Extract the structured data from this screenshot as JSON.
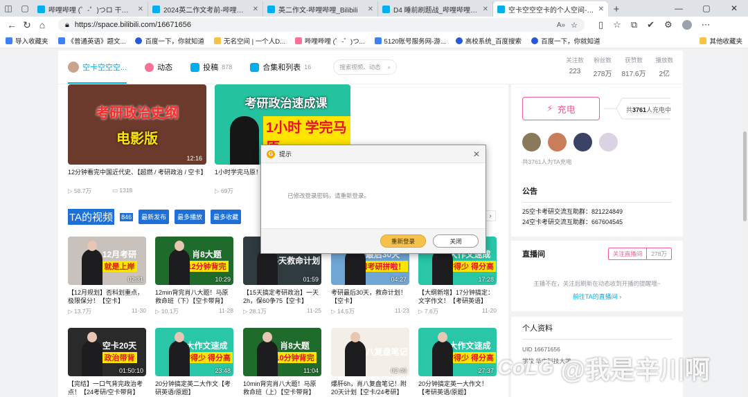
{
  "browser": {
    "tabs": [
      {
        "title": "哔哩哔哩 (゜-゜)つロ 干杯~-bilibili",
        "active": false
      },
      {
        "title": "2024英二作文考前-哔哩哔哩_Bilibili",
        "active": false
      },
      {
        "title": "英二作文-哔哩哔哩_Bilibili",
        "active": false
      },
      {
        "title": "D4 睡前刷题战_哔哩哔哩_bilibili",
        "active": false
      },
      {
        "title": "空卡空空空卡的个人空间-空卡",
        "active": true
      }
    ],
    "url": "https://space.bilibili.com/16671656",
    "reader_label": "A»",
    "bookmarks": [
      {
        "label": "导入收藏夹",
        "icon": "import-icon"
      },
      {
        "label": "《普通英语》题文...",
        "icon": "bookmark-icon"
      },
      {
        "label": "百度一下，你就知道",
        "icon": "baidu-paw-icon"
      },
      {
        "label": "无名空间 | 一个人D...",
        "icon": "bookmark-icon"
      },
      {
        "label": "哔哩哔哩 (゜-゜)つ...",
        "icon": "bilibili-icon"
      },
      {
        "label": "5120账号服务网-游...",
        "icon": "bookmark-icon"
      },
      {
        "label": "高校系统_百度搜索",
        "icon": "baidu-paw-icon"
      },
      {
        "label": "百度一下，你就知道",
        "icon": "baidu-paw-icon"
      }
    ],
    "other_bookmarks": "其他收藏夹"
  },
  "nav": {
    "username": "空卡空空空...",
    "dynamics": "动态",
    "submissions": "投稿",
    "submissions_count": "878",
    "collections": "合集和列表",
    "collections_count": "16",
    "search_placeholder": "搜索视频、动态",
    "stats": [
      {
        "label": "关注数",
        "value": "223"
      },
      {
        "label": "粉丝数",
        "value": "278万"
      },
      {
        "label": "获赞数",
        "value": "817.6万"
      },
      {
        "label": "播放数",
        "value": "2亿"
      }
    ]
  },
  "top_videos": [
    {
      "thumb_title": "考研政治史纲",
      "thumb_sub": "电影版",
      "duration": "12:16",
      "title": "12分钟看完中国近代史、【超燃 / 考研政治 / 空卡】",
      "plays": "58.7万",
      "danmaku": "1318",
      "bg": "#6b3a2c"
    },
    {
      "thumb_title": "考研政治速成课",
      "thumb_sub": "1小时 学完马原",
      "duration": "",
      "title": "1小时学完马原！",
      "plays": "69万",
      "danmaku": "",
      "bg": "#25c2a0"
    }
  ],
  "videos_section": {
    "title": "TA的视频",
    "count": "846",
    "sort_newest": "最新发布",
    "sort_most_played": "最多播放",
    "sort_most_fav": "最多收藏"
  },
  "videos": [
    {
      "thumb_title": "12月考研",
      "thumb_sub": "就是上岸",
      "duration": "02:31",
      "title": "【12月规划】否科划重点，极限保分！【空卡】",
      "plays": "13.7万",
      "date": "11-30",
      "bg": "#c9c2bc"
    },
    {
      "thumb_title": "肖8大题",
      "thumb_sub": "12分钟背完",
      "duration": "10:29",
      "title": "12min背完肖八大题！马原救命班（下）【空卡带背】",
      "plays": "10.1万",
      "date": "11-28",
      "bg": "#1f6b2c"
    },
    {
      "thumb_title": "15天救命计划",
      "thumb_sub": "",
      "duration": "01:59",
      "title": "【15天搞定考研政治】一天2h，保60争75【空卡】",
      "plays": "28.1万",
      "date": "11-25",
      "bg": "#2f3b3f"
    },
    {
      "thumb_title": "最后30天",
      "thumb_sub": "和考研拼啦！",
      "duration": "04:27",
      "title": "考研最后30天，救命计划！【空卡】",
      "plays": "14.5万",
      "date": "11-23",
      "bg": "#6fa6d6"
    },
    {
      "thumb_title": "大作文速成",
      "thumb_sub": "背得少 得分高",
      "duration": "17:28",
      "title": "【大纲新增】17分钟搞定：文字作文！【考研英语】",
      "plays": "7.6万",
      "date": "11-20",
      "bg": "#29c6a8"
    },
    {
      "thumb_title": "空卡20天",
      "thumb_sub": "政治带背",
      "duration": "01:50:10",
      "title": "【完结】一口气背完政治考点！【24考研/空卡带背】",
      "plays": "",
      "date": "",
      "bg": "#2a2a2a"
    },
    {
      "thumb_title": "大作文速成",
      "thumb_sub": "背得少 得分高",
      "duration": "23:48",
      "title": "20分钟搞定英二大作文【考研英语/原题】",
      "plays": "",
      "date": "",
      "bg": "#29c6a8"
    },
    {
      "thumb_title": "肖8大题",
      "thumb_sub": "10分钟背完",
      "duration": "11:04",
      "title": "10min背完肖八大题！马原救命班（上）【空卡带背】",
      "plays": "",
      "date": "",
      "bg": "#1f6b2c"
    },
    {
      "thumb_title": "肖八复盘笔记",
      "thumb_sub": "",
      "duration": "02:49",
      "title": "爆肝6h，肖八复盘笔记！附20天计划【空卡/24考研】",
      "plays": "",
      "date": "",
      "bg": "#f3efe6"
    },
    {
      "thumb_title": "大作文速成",
      "thumb_sub": "背得少 得分高",
      "duration": "27:37",
      "title": "20分钟搞定英一大作文！【考研英语/原题】",
      "plays": "",
      "date": "",
      "bg": "#29c6a8"
    }
  ],
  "sidebar": {
    "charge_label": "充电",
    "charge_count_prefix": "共",
    "charge_count": "3761",
    "charge_count_suffix": "人充电中",
    "charge_note": "共3761人为TA充电",
    "notice_title": "公告",
    "notice_lines": [
      "25空卡考研交流互助群：821224849",
      "24空卡考研交流互助群：667604545"
    ],
    "live_title": "直播间",
    "live_follow": "关注直播间",
    "live_follow_count": "278万",
    "live_empty": "主播不在，关注后刷新在动态收到开播的提醒哦~",
    "live_link": "前往TA的直播间",
    "profile_title": "个人资料",
    "profile_uid_label": "UID",
    "profile_uid": "16671656",
    "profile_school_label": "学校",
    "profile_school": "华中科技大学"
  },
  "modal": {
    "title": "提示",
    "message": "已修改登录密码，请重新登录。",
    "relogin": "重新登录",
    "close": "关闭"
  },
  "watermark": {
    "logo": "CoLG",
    "handle": "@我是辛川啊"
  }
}
